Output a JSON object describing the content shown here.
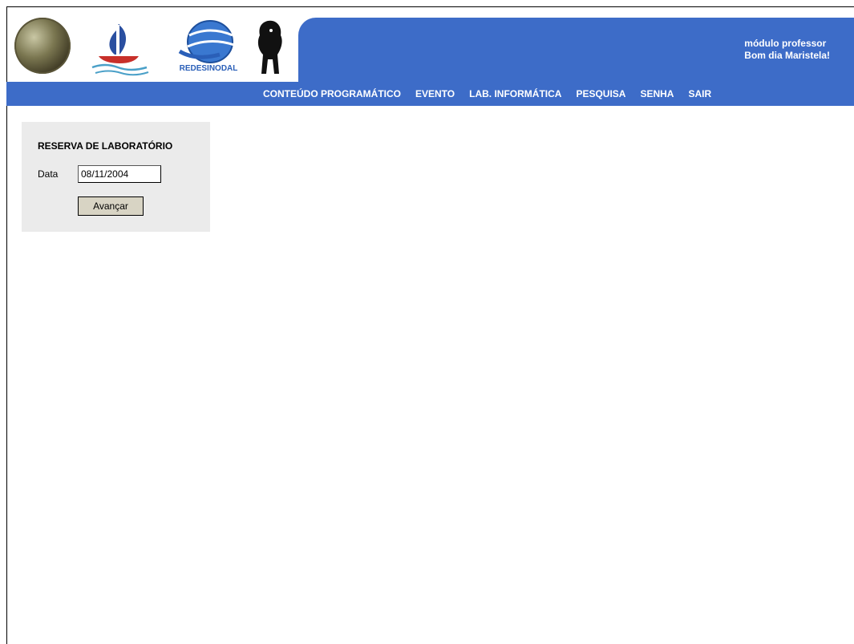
{
  "header": {
    "logo_text": "REDESINODAL",
    "module": "módulo professor",
    "greeting": "Bom dia Maristela!"
  },
  "nav": {
    "items": [
      "CONTEÚDO PROGRAMÁTICO",
      "EVENTO",
      "LAB. INFORMÁTICA",
      "PESQUISA",
      "SENHA",
      "SAIR"
    ]
  },
  "form": {
    "title": "RESERVA DE LABORATÓRIO",
    "date_label": "Data",
    "date_value": "08/11/2004",
    "submit_label": "Avançar"
  },
  "colors": {
    "header_blue": "#3d6cc8",
    "panel_gray": "#ebebeb",
    "button_beige": "#d8d4c4"
  }
}
